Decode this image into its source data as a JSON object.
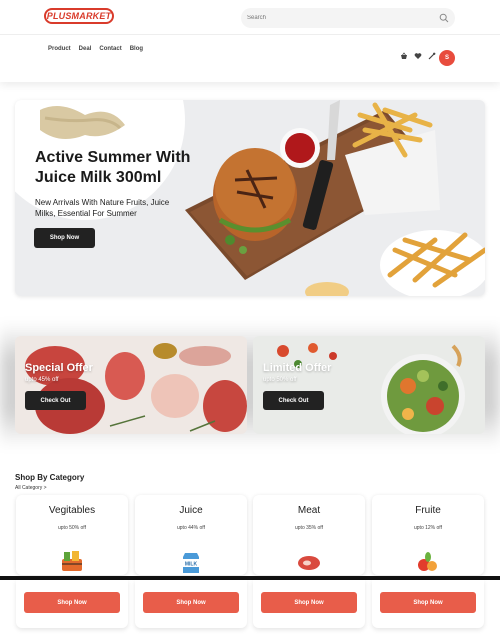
{
  "header": {
    "logo_text": "PLUSMARKET",
    "search_placeholder": "Search",
    "nav": [
      "Product",
      "Deal",
      "Contact",
      "Blog"
    ],
    "avatar_label": "S",
    "icons": [
      "basket-icon",
      "heart-icon",
      "tools-icon"
    ]
  },
  "hero": {
    "title": "Active Summer With Juice Milk 300ml",
    "subtitle": "New Arrivals With Nature Fruits, Juice Milks, Essential For Summer",
    "button": "Shop Now"
  },
  "offers": [
    {
      "title": "Special Offer",
      "subtitle": "upto 45% off",
      "button": "Check Out"
    },
    {
      "title": "Limited Offer",
      "subtitle": "upto 50% off",
      "button": "Check Out"
    }
  ],
  "category": {
    "title": "Shop By Category",
    "all_link": "All Category >",
    "cards": [
      {
        "name": "Vegitables",
        "offer": "upto 50% off",
        "icon": "vegetables-basket-icon",
        "button": "Shop Now"
      },
      {
        "name": "Juice",
        "offer": "upto 44% off",
        "icon": "milk-carton-icon",
        "button": "Shop Now"
      },
      {
        "name": "Meat",
        "offer": "upto 35% off",
        "icon": "steak-icon",
        "button": "Shop Now"
      },
      {
        "name": "Fruite",
        "offer": "upto 12% off",
        "icon": "fruits-icon",
        "button": "Shop Now"
      }
    ]
  },
  "colors": {
    "accent": "#e85d4a",
    "dark": "#222222",
    "logo": "#d93b2b"
  }
}
